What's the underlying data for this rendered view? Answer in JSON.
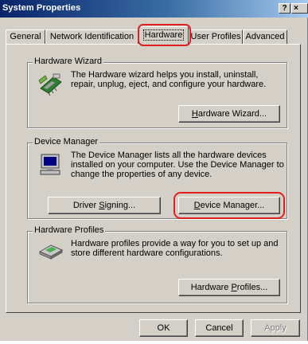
{
  "window": {
    "title": "System Properties",
    "help_label": "?",
    "close_label": "×"
  },
  "tabs": [
    {
      "label": "General"
    },
    {
      "label": "Network Identification"
    },
    {
      "label": "Hardware"
    },
    {
      "label": "User Profiles"
    },
    {
      "label": "Advanced"
    }
  ],
  "hardware_wizard": {
    "title": "Hardware Wizard",
    "description": "The Hardware wizard helps you install, uninstall, repair, unplug, eject, and configure your hardware.",
    "button_label_prefix": "",
    "button_mnemonic": "H",
    "button_label_suffix": "ardware Wizard..."
  },
  "device_manager": {
    "title": "Device Manager",
    "description": "The Device Manager lists all the hardware devices installed on your computer. Use the Device Manager to change the properties of any device.",
    "signing_prefix": "Driver ",
    "signing_mnemonic": "S",
    "signing_suffix": "igning...",
    "dm_prefix": "",
    "dm_mnemonic": "D",
    "dm_suffix": "evice Manager..."
  },
  "hardware_profiles": {
    "title": "Hardware Profiles",
    "description": "Hardware profiles provide a way for you to set up and store different hardware configurations.",
    "button_prefix": "Hardware ",
    "button_mnemonic": "P",
    "button_suffix": "rofiles..."
  },
  "footer": {
    "ok_label": "OK",
    "cancel_label": "Cancel",
    "apply_label": "Apply"
  },
  "highlight_color": "#e02020"
}
